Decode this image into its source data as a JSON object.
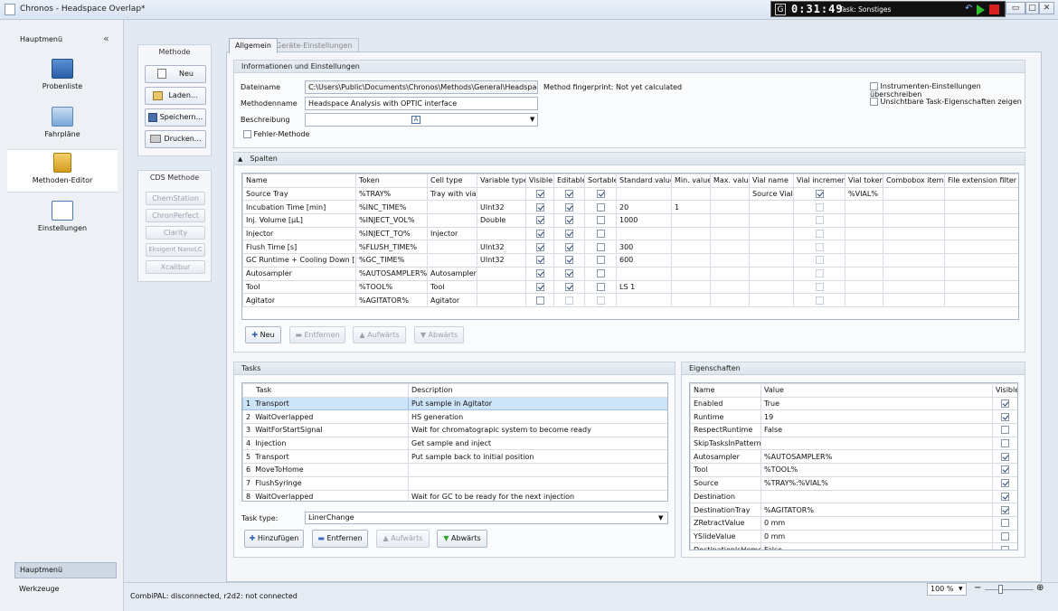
{
  "window": {
    "title": "Chronos  - Headspace Overlap*",
    "minimize": "▭",
    "maximize": "□",
    "close": "✕"
  },
  "timer": {
    "logo": "G",
    "time": "0:31:49",
    "task_label": "Task: Sonstiges"
  },
  "sidebar": {
    "title": "Hauptmenü",
    "collapse": "«",
    "items": [
      {
        "label": "Probenliste",
        "icon": "list-grid-icon"
      },
      {
        "label": "Fahrpläne",
        "icon": "schedule-icon"
      },
      {
        "label": "Methoden-Editor",
        "icon": "folder-icon"
      },
      {
        "label": "Einstellungen",
        "icon": "checklist-icon"
      }
    ],
    "bottom_tabs": [
      "Hauptmenü",
      "Werkzeuge"
    ]
  },
  "methode_group": {
    "title": "Methode",
    "buttons": [
      "Neu",
      "Laden...",
      "Speichern...",
      "Drucken..."
    ]
  },
  "cds_group": {
    "title": "CDS Methode",
    "buttons": [
      "ChemStation",
      "ChronPerfect",
      "Clarity",
      "Eksigent NanoLC",
      "Xcalibur"
    ]
  },
  "tabs": [
    "Allgemein",
    "Geräte-Einstellungen"
  ],
  "info": {
    "header": "Informationen und Einstellungen",
    "dateiname_label": "Dateiname",
    "dateiname": "C:\\Users\\Public\\Documents\\Chronos\\Methods\\General\\Headspace Gene",
    "fingerprint": "Method fingerprint: Not yet calculated",
    "methodenname_label": "Methodenname",
    "methodenname": "Headspace Analysis with OPTIC interface",
    "beschreibung_label": "Beschreibung",
    "beschreibung": "",
    "fehler_label": "Fehler-Methode",
    "instr_label": "Instrumenten-Einstellungen überschreiben",
    "unsichtbar_label": "Unsichtbare Task-Eigenschaften zeigen"
  },
  "spalten": {
    "header": "Spalten",
    "columns": [
      "Name",
      "Token",
      "Cell type",
      "Variable type",
      "Visible",
      "Editable",
      "Sortable",
      "Standard value",
      "Min. value",
      "Max. value",
      "Vial name",
      "Vial increment",
      "Vial token",
      "Combobox items",
      "File extension filter"
    ],
    "rows": [
      {
        "name": "Source Tray",
        "token": "%TRAY%",
        "cell": "Tray with vial",
        "vtype": "",
        "visible": true,
        "editable": true,
        "sortable": true,
        "std": "",
        "min": "",
        "max": "",
        "vialname": "Source Vial",
        "vialinc": true,
        "vialtoken": "%VIAL%"
      },
      {
        "name": "Incubation Time [min]",
        "token": "%INC_TIME%",
        "cell": "",
        "vtype": "UInt32",
        "visible": true,
        "editable": true,
        "sortable": false,
        "std": "20",
        "min": "1",
        "max": "",
        "vialname": "",
        "vialinc": false,
        "vialtoken": ""
      },
      {
        "name": "Inj. Volume [µL]",
        "token": "%INJECT_VOL%",
        "cell": "",
        "vtype": "Double",
        "visible": true,
        "editable": true,
        "sortable": false,
        "std": "1000",
        "min": "",
        "max": "",
        "vialname": "",
        "vialinc": false,
        "vialtoken": ""
      },
      {
        "name": "Injector",
        "token": "%INJECT_TO%",
        "cell": "Injector",
        "vtype": "",
        "visible": true,
        "editable": true,
        "sortable": false,
        "std": "",
        "min": "",
        "max": "",
        "vialname": "",
        "vialinc": false,
        "vialtoken": ""
      },
      {
        "name": "Flush Time [s]",
        "token": "%FLUSH_TIME%",
        "cell": "",
        "vtype": "UInt32",
        "visible": true,
        "editable": true,
        "sortable": false,
        "std": "300",
        "min": "",
        "max": "",
        "vialname": "",
        "vialinc": false,
        "vialtoken": ""
      },
      {
        "name": "GC Runtime + Cooling Down [s]",
        "token": "%GC_TIME%",
        "cell": "",
        "vtype": "UInt32",
        "visible": true,
        "editable": true,
        "sortable": false,
        "std": "600",
        "min": "",
        "max": "",
        "vialname": "",
        "vialinc": false,
        "vialtoken": ""
      },
      {
        "name": "Autosampler",
        "token": "%AUTOSAMPLER%",
        "cell": "Autosampler",
        "vtype": "",
        "visible": true,
        "editable": true,
        "sortable": false,
        "std": "",
        "min": "",
        "max": "",
        "vialname": "",
        "vialinc": false,
        "vialtoken": ""
      },
      {
        "name": "Tool",
        "token": "%TOOL%",
        "cell": "Tool",
        "vtype": "",
        "visible": true,
        "editable": true,
        "sortable": false,
        "std": "LS 1",
        "min": "",
        "max": "",
        "vialname": "",
        "vialinc": false,
        "vialtoken": ""
      },
      {
        "name": "Agitator",
        "token": "%AGITATOR%",
        "cell": "Agitator",
        "vtype": "",
        "visible": false,
        "editable": false,
        "sortable": false,
        "std": "",
        "min": "",
        "max": "",
        "vialname": "",
        "vialinc": false,
        "vialtoken": ""
      }
    ],
    "buttons": [
      "Neu",
      "Entfernen",
      "Aufwärts",
      "Abwärts"
    ]
  },
  "tasks": {
    "header": "Tasks",
    "columns": [
      "Task",
      "Description"
    ],
    "rows": [
      {
        "n": "1",
        "task": "Transport",
        "desc": "Put sample in Agitator"
      },
      {
        "n": "2",
        "task": "WaitOverlapped",
        "desc": "HS generation"
      },
      {
        "n": "3",
        "task": "WaitForStartSignal",
        "desc": "Wait for chromatograpic system to become ready"
      },
      {
        "n": "4",
        "task": "Injection",
        "desc": "Get sample and inject"
      },
      {
        "n": "5",
        "task": "Transport",
        "desc": "Put sample back to initial position"
      },
      {
        "n": "6",
        "task": "MoveToHome",
        "desc": ""
      },
      {
        "n": "7",
        "task": "FlushSyringe",
        "desc": ""
      },
      {
        "n": "8",
        "task": "WaitOverlapped",
        "desc": "Wait for GC to be ready for the next injection"
      }
    ],
    "tasktype_label": "Task type:",
    "tasktype": "LinerChange",
    "buttons": [
      "Hinzufügen",
      "Entfernen",
      "Aufwärts",
      "Abwärts"
    ]
  },
  "props": {
    "header": "Eigenschaften",
    "columns": [
      "Name",
      "Value",
      "Visible"
    ],
    "rows": [
      {
        "name": "Enabled",
        "value": "True",
        "vis": true
      },
      {
        "name": "Runtime",
        "value": "19",
        "vis": true
      },
      {
        "name": "RespectRuntime",
        "value": "False",
        "vis": false
      },
      {
        "name": "SkipTasksInPattern",
        "value": "",
        "vis": false
      },
      {
        "name": "Autosampler",
        "value": "%AUTOSAMPLER%",
        "vis": true
      },
      {
        "name": "Tool",
        "value": "%TOOL%",
        "vis": true
      },
      {
        "name": "Source",
        "value": "%TRAY%:%VIAL%",
        "vis": true
      },
      {
        "name": "Destination",
        "value": "",
        "vis": true
      },
      {
        "name": "DestinationTray",
        "value": "%AGITATOR%",
        "vis": true
      },
      {
        "name": "ZRetractValue",
        "value": "0 mm",
        "vis": false
      },
      {
        "name": "YSlideValue",
        "value": "0 mm",
        "vis": false
      },
      {
        "name": "DestinationIsHome",
        "value": "False",
        "vis": false
      }
    ]
  },
  "status": {
    "text": "CombiPAL: disconnected, r2d2: not connected",
    "zoom": "100 %"
  }
}
